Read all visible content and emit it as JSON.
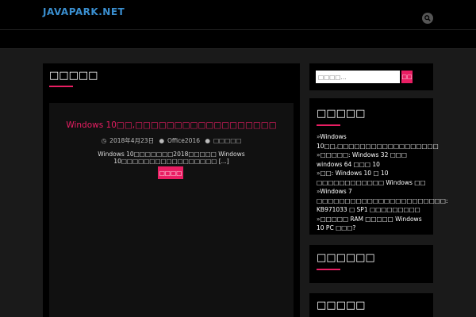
{
  "header": {
    "logo": "JAVAPARK.NET",
    "search_icon": "search-icon"
  },
  "main": {
    "section_title": "□□□□□",
    "post": {
      "title": "Windows 10□□,□□□□□□□□□□□□□□□□□□",
      "date": "2018年4月23日",
      "author": "Office2016",
      "comments": "□□□□□",
      "excerpt": "Windows 10□□□□□□□2018□□□□□ Windows 10□□□□□□□□□□□□□□□□□ [...]",
      "more_label": "□□□□"
    }
  },
  "sidebar": {
    "search": {
      "placeholder": "□□□□...",
      "submit_label": "□□"
    },
    "recent_title": "□□□□□",
    "recent_posts": [
      "Windows 10□□,□□□□□□□□□□□□□□□□□□",
      "□□□□□: Windows 32 □□□ windows 64 □□□ 10",
      "□□: Windows 10 □ 10 □□□□□□□□□□□□ Windows □□",
      "Windows 7 □□□□□□□□□□□□□□□□□□□□□□□: KB971033 □ SP1 □□□□□□□□□",
      "□□□□□ RAM □□□□□ Windows 10 PC □□□?"
    ],
    "archive_title": "□□□□□□",
    "categories_title": "□□□□□"
  },
  "colors": {
    "accent": "#e91e63",
    "logo": "#3a8fd0"
  }
}
